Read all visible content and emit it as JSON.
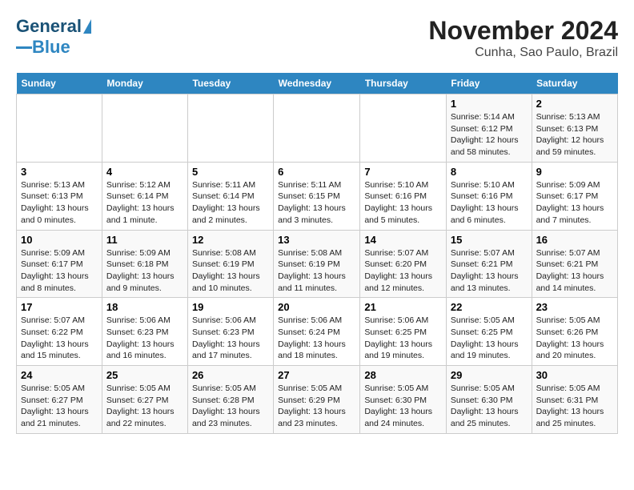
{
  "logo": {
    "line1": "General",
    "line2": "Blue"
  },
  "title": "November 2024",
  "subtitle": "Cunha, Sao Paulo, Brazil",
  "weekdays": [
    "Sunday",
    "Monday",
    "Tuesday",
    "Wednesday",
    "Thursday",
    "Friday",
    "Saturday"
  ],
  "weeks": [
    [
      {
        "day": "",
        "info": ""
      },
      {
        "day": "",
        "info": ""
      },
      {
        "day": "",
        "info": ""
      },
      {
        "day": "",
        "info": ""
      },
      {
        "day": "",
        "info": ""
      },
      {
        "day": "1",
        "info": "Sunrise: 5:14 AM\nSunset: 6:12 PM\nDaylight: 12 hours and 58 minutes."
      },
      {
        "day": "2",
        "info": "Sunrise: 5:13 AM\nSunset: 6:13 PM\nDaylight: 12 hours and 59 minutes."
      }
    ],
    [
      {
        "day": "3",
        "info": "Sunrise: 5:13 AM\nSunset: 6:13 PM\nDaylight: 13 hours and 0 minutes."
      },
      {
        "day": "4",
        "info": "Sunrise: 5:12 AM\nSunset: 6:14 PM\nDaylight: 13 hours and 1 minute."
      },
      {
        "day": "5",
        "info": "Sunrise: 5:11 AM\nSunset: 6:14 PM\nDaylight: 13 hours and 2 minutes."
      },
      {
        "day": "6",
        "info": "Sunrise: 5:11 AM\nSunset: 6:15 PM\nDaylight: 13 hours and 3 minutes."
      },
      {
        "day": "7",
        "info": "Sunrise: 5:10 AM\nSunset: 6:16 PM\nDaylight: 13 hours and 5 minutes."
      },
      {
        "day": "8",
        "info": "Sunrise: 5:10 AM\nSunset: 6:16 PM\nDaylight: 13 hours and 6 minutes."
      },
      {
        "day": "9",
        "info": "Sunrise: 5:09 AM\nSunset: 6:17 PM\nDaylight: 13 hours and 7 minutes."
      }
    ],
    [
      {
        "day": "10",
        "info": "Sunrise: 5:09 AM\nSunset: 6:17 PM\nDaylight: 13 hours and 8 minutes."
      },
      {
        "day": "11",
        "info": "Sunrise: 5:09 AM\nSunset: 6:18 PM\nDaylight: 13 hours and 9 minutes."
      },
      {
        "day": "12",
        "info": "Sunrise: 5:08 AM\nSunset: 6:19 PM\nDaylight: 13 hours and 10 minutes."
      },
      {
        "day": "13",
        "info": "Sunrise: 5:08 AM\nSunset: 6:19 PM\nDaylight: 13 hours and 11 minutes."
      },
      {
        "day": "14",
        "info": "Sunrise: 5:07 AM\nSunset: 6:20 PM\nDaylight: 13 hours and 12 minutes."
      },
      {
        "day": "15",
        "info": "Sunrise: 5:07 AM\nSunset: 6:21 PM\nDaylight: 13 hours and 13 minutes."
      },
      {
        "day": "16",
        "info": "Sunrise: 5:07 AM\nSunset: 6:21 PM\nDaylight: 13 hours and 14 minutes."
      }
    ],
    [
      {
        "day": "17",
        "info": "Sunrise: 5:07 AM\nSunset: 6:22 PM\nDaylight: 13 hours and 15 minutes."
      },
      {
        "day": "18",
        "info": "Sunrise: 5:06 AM\nSunset: 6:23 PM\nDaylight: 13 hours and 16 minutes."
      },
      {
        "day": "19",
        "info": "Sunrise: 5:06 AM\nSunset: 6:23 PM\nDaylight: 13 hours and 17 minutes."
      },
      {
        "day": "20",
        "info": "Sunrise: 5:06 AM\nSunset: 6:24 PM\nDaylight: 13 hours and 18 minutes."
      },
      {
        "day": "21",
        "info": "Sunrise: 5:06 AM\nSunset: 6:25 PM\nDaylight: 13 hours and 19 minutes."
      },
      {
        "day": "22",
        "info": "Sunrise: 5:05 AM\nSunset: 6:25 PM\nDaylight: 13 hours and 19 minutes."
      },
      {
        "day": "23",
        "info": "Sunrise: 5:05 AM\nSunset: 6:26 PM\nDaylight: 13 hours and 20 minutes."
      }
    ],
    [
      {
        "day": "24",
        "info": "Sunrise: 5:05 AM\nSunset: 6:27 PM\nDaylight: 13 hours and 21 minutes."
      },
      {
        "day": "25",
        "info": "Sunrise: 5:05 AM\nSunset: 6:27 PM\nDaylight: 13 hours and 22 minutes."
      },
      {
        "day": "26",
        "info": "Sunrise: 5:05 AM\nSunset: 6:28 PM\nDaylight: 13 hours and 23 minutes."
      },
      {
        "day": "27",
        "info": "Sunrise: 5:05 AM\nSunset: 6:29 PM\nDaylight: 13 hours and 23 minutes."
      },
      {
        "day": "28",
        "info": "Sunrise: 5:05 AM\nSunset: 6:30 PM\nDaylight: 13 hours and 24 minutes."
      },
      {
        "day": "29",
        "info": "Sunrise: 5:05 AM\nSunset: 6:30 PM\nDaylight: 13 hours and 25 minutes."
      },
      {
        "day": "30",
        "info": "Sunrise: 5:05 AM\nSunset: 6:31 PM\nDaylight: 13 hours and 25 minutes."
      }
    ]
  ]
}
